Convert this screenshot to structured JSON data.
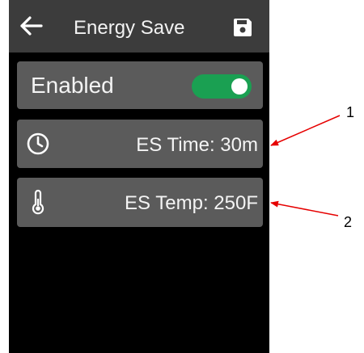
{
  "header": {
    "title": "Energy Save",
    "back_icon": "arrow-left-icon",
    "save_icon": "floppy-disk-icon"
  },
  "settings": {
    "enabled": {
      "label": "Enabled",
      "toggle_on": true,
      "toggle_color": "#1aa052"
    },
    "es_time": {
      "icon": "clock-icon",
      "label": "ES Time: 30m"
    },
    "es_temp": {
      "icon": "thermometer-icon",
      "label": "ES Temp: 250F"
    }
  },
  "annotations": {
    "color": "#e60000",
    "callouts": [
      "1",
      "2"
    ]
  }
}
